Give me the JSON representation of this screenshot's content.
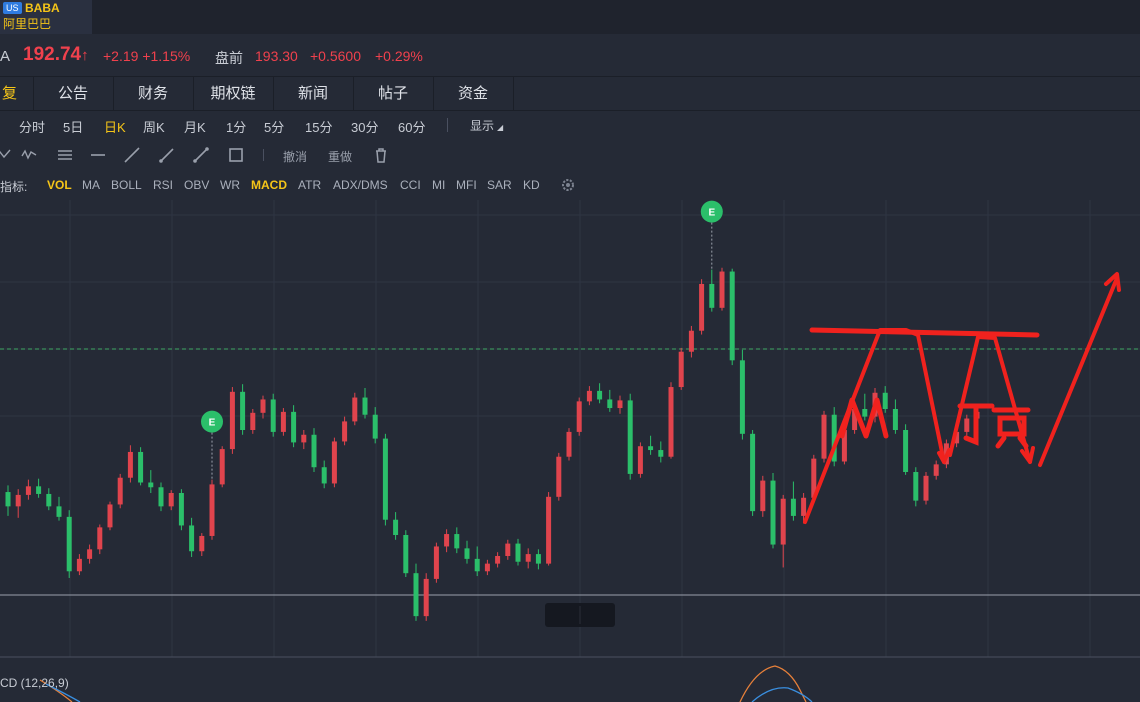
{
  "ticker": {
    "market_badge": "US",
    "symbol": "BABA",
    "name": "阿里巴巴"
  },
  "quote": {
    "prefix": "A",
    "price": "192.74",
    "price_arrow": "↑",
    "change": "+2.19 +1.15%",
    "premarket_label": "盘前",
    "premarket_price": "193.30",
    "premarket_change": "+0.5600",
    "premarket_pct": "+0.29%"
  },
  "tabs": [
    {
      "label": "复",
      "active": true
    },
    {
      "label": "公告"
    },
    {
      "label": "财务"
    },
    {
      "label": "期权链"
    },
    {
      "label": "新闻"
    },
    {
      "label": "帖子"
    },
    {
      "label": "资金"
    }
  ],
  "periods": [
    {
      "label": "分时"
    },
    {
      "label": "5日"
    },
    {
      "label": "日K",
      "active": true
    },
    {
      "label": "周K"
    },
    {
      "label": "月K"
    },
    {
      "label": "1分"
    },
    {
      "label": "5分"
    },
    {
      "label": "15分"
    },
    {
      "label": "30分"
    },
    {
      "label": "60分"
    }
  ],
  "display_menu": "显示",
  "drawing_tools": {
    "undo": "撤消",
    "redo": "重做",
    "icons": [
      "wave-icon",
      "parallel-lines-icon",
      "horizontal-line-icon",
      "trend-line-icon",
      "ray-line-icon",
      "arrow-line-icon",
      "rectangle-icon",
      "trash-icon"
    ]
  },
  "indicators": {
    "label": "指标:",
    "items": [
      {
        "label": "VOL",
        "active": true
      },
      {
        "label": "MA"
      },
      {
        "label": "BOLL"
      },
      {
        "label": "RSI"
      },
      {
        "label": "OBV"
      },
      {
        "label": "WR"
      },
      {
        "label": "MACD",
        "active": true
      },
      {
        "label": "ATR"
      },
      {
        "label": "ADX/DMS"
      },
      {
        "label": "CCI"
      },
      {
        "label": "MI"
      },
      {
        "label": "MFI"
      },
      {
        "label": "SAR"
      },
      {
        "label": "KD"
      }
    ]
  },
  "chart": {
    "annotation_text": "M 顶",
    "event_marker": "E",
    "macd_label": "CD (12,26,9)",
    "colors": {
      "up": "#e0444d",
      "down": "#2bbf6a",
      "annotation": "#f0221e",
      "accent": "#f5c518",
      "background": "#252a36"
    }
  },
  "chart_data": {
    "type": "candlestick",
    "series_up_color": "#e0444d",
    "series_down_color": "#2bbf6a",
    "candles_note": "",
    "candles": [
      [
        189.5,
        190.2,
        187.0,
        188.0
      ],
      [
        188.0,
        189.8,
        186.8,
        189.2
      ],
      [
        189.2,
        190.8,
        188.7,
        190.1
      ],
      [
        190.1,
        190.9,
        188.9,
        189.3
      ],
      [
        189.3,
        189.9,
        187.6,
        188.0
      ],
      [
        188.0,
        189.0,
        186.5,
        186.9
      ],
      [
        186.9,
        187.6,
        180.5,
        181.2
      ],
      [
        181.2,
        183.0,
        180.8,
        182.5
      ],
      [
        182.5,
        184.0,
        182.0,
        183.5
      ],
      [
        183.5,
        186.1,
        183.0,
        185.8
      ],
      [
        185.8,
        188.5,
        185.5,
        188.2
      ],
      [
        188.2,
        191.4,
        187.8,
        191.0
      ],
      [
        191.0,
        194.4,
        190.5,
        193.7
      ],
      [
        193.7,
        194.2,
        190.2,
        190.5
      ],
      [
        190.5,
        191.8,
        189.4,
        190.0
      ],
      [
        190.0,
        190.5,
        187.5,
        188.0
      ],
      [
        188.0,
        189.7,
        187.6,
        189.4
      ],
      [
        189.4,
        189.8,
        185.5,
        186.0
      ],
      [
        186.0,
        186.8,
        182.7,
        183.3
      ],
      [
        183.3,
        185.2,
        182.8,
        184.9
      ],
      [
        184.9,
        190.8,
        184.5,
        190.3
      ],
      [
        190.3,
        194.3,
        190.0,
        194.0
      ],
      [
        194.0,
        200.5,
        193.5,
        200.0
      ],
      [
        200.0,
        200.8,
        195.5,
        196.0
      ],
      [
        196.0,
        198.2,
        195.6,
        197.8
      ],
      [
        197.8,
        199.6,
        197.2,
        199.2
      ],
      [
        199.2,
        199.8,
        195.3,
        195.8
      ],
      [
        195.8,
        198.3,
        195.4,
        197.9
      ],
      [
        197.9,
        198.6,
        194.2,
        194.7
      ],
      [
        194.7,
        196.0,
        194.0,
        195.5
      ],
      [
        195.5,
        196.2,
        191.6,
        192.1
      ],
      [
        192.1,
        192.8,
        189.9,
        190.4
      ],
      [
        190.4,
        195.2,
        190.0,
        194.8
      ],
      [
        194.8,
        197.4,
        194.4,
        196.9
      ],
      [
        196.9,
        199.9,
        196.5,
        199.4
      ],
      [
        199.4,
        200.4,
        197.2,
        197.6
      ],
      [
        197.6,
        198.4,
        194.6,
        195.1
      ],
      [
        195.1,
        195.6,
        186.0,
        186.6
      ],
      [
        186.6,
        187.4,
        184.5,
        185.0
      ],
      [
        185.0,
        185.5,
        180.6,
        181.0
      ],
      [
        181.0,
        182.0,
        176.0,
        176.5
      ],
      [
        176.5,
        181.0,
        176.0,
        180.4
      ],
      [
        180.4,
        184.2,
        180.0,
        183.8
      ],
      [
        183.8,
        185.6,
        183.2,
        185.1
      ],
      [
        185.1,
        185.8,
        183.1,
        183.6
      ],
      [
        183.6,
        184.4,
        182.0,
        182.5
      ],
      [
        182.5,
        183.8,
        180.7,
        181.2
      ],
      [
        181.2,
        182.4,
        180.8,
        182.0
      ],
      [
        182.0,
        183.2,
        181.6,
        182.8
      ],
      [
        182.8,
        184.5,
        182.4,
        184.1
      ],
      [
        184.1,
        184.6,
        181.8,
        182.2
      ],
      [
        182.2,
        183.6,
        181.5,
        183.0
      ],
      [
        183.0,
        183.5,
        181.4,
        182.0
      ],
      [
        182.0,
        189.5,
        181.8,
        189.0
      ],
      [
        189.0,
        193.6,
        188.6,
        193.2
      ],
      [
        193.2,
        196.2,
        192.8,
        195.8
      ],
      [
        195.8,
        199.4,
        195.4,
        199.0
      ],
      [
        199.0,
        200.6,
        198.6,
        200.1
      ],
      [
        200.1,
        200.9,
        198.8,
        199.2
      ],
      [
        199.2,
        200.2,
        197.9,
        198.3
      ],
      [
        198.3,
        199.6,
        197.7,
        199.1
      ],
      [
        199.1,
        199.8,
        190.8,
        191.4
      ],
      [
        191.4,
        194.7,
        191.0,
        194.3
      ],
      [
        194.3,
        195.4,
        193.4,
        193.9
      ],
      [
        193.9,
        194.8,
        192.6,
        193.2
      ],
      [
        193.2,
        201.0,
        193.0,
        200.5
      ],
      [
        200.5,
        204.6,
        200.2,
        204.2
      ],
      [
        204.2,
        206.9,
        203.6,
        206.4
      ],
      [
        206.4,
        211.8,
        206.0,
        211.3
      ],
      [
        211.3,
        212.8,
        208.4,
        208.8
      ],
      [
        208.8,
        213.0,
        208.5,
        212.6
      ],
      [
        212.6,
        212.9,
        202.8,
        203.3
      ],
      [
        203.3,
        204.4,
        195.0,
        195.6
      ],
      [
        195.6,
        196.0,
        187.0,
        187.5
      ],
      [
        187.5,
        191.2,
        186.9,
        190.7
      ],
      [
        190.7,
        191.5,
        183.6,
        184.0
      ],
      [
        184.0,
        189.2,
        181.6,
        188.8
      ],
      [
        188.8,
        190.6,
        186.5,
        187.0
      ],
      [
        187.0,
        189.4,
        186.2,
        188.9
      ],
      [
        188.9,
        193.4,
        188.4,
        193.0
      ],
      [
        193.0,
        198.0,
        192.6,
        197.6
      ],
      [
        197.6,
        198.4,
        192.2,
        192.7
      ],
      [
        192.7,
        196.4,
        192.4,
        196.0
      ],
      [
        196.0,
        198.6,
        195.6,
        198.2
      ],
      [
        198.2,
        199.8,
        197.0,
        197.4
      ],
      [
        197.4,
        200.4,
        196.8,
        199.9
      ],
      [
        199.9,
        200.6,
        197.8,
        198.2
      ],
      [
        198.2,
        199.2,
        195.6,
        196.0
      ],
      [
        196.0,
        196.6,
        191.3,
        191.6
      ],
      [
        191.6,
        192.1,
        188.0,
        188.6
      ],
      [
        188.6,
        191.6,
        188.2,
        191.2
      ],
      [
        191.2,
        192.8,
        190.8,
        192.4
      ],
      [
        192.4,
        195.0,
        192.0,
        194.6
      ],
      [
        194.6,
        196.2,
        194.2,
        195.8
      ],
      [
        195.8,
        197.6,
        195.4,
        197.2
      ],
      [
        197.2,
        198.4,
        196.6,
        197.9
      ]
    ],
    "y_range": [
      174,
      218
    ],
    "reference_price": 197.5,
    "event_markers": [
      {
        "index": 20,
        "label": "E"
      },
      {
        "index": 69,
        "label": "E"
      }
    ],
    "annotation": "M 顶"
  }
}
